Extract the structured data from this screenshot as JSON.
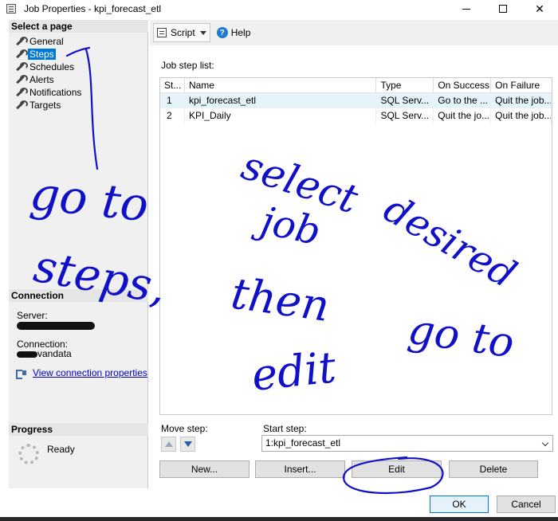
{
  "window": {
    "title": "Job Properties - kpi_forecast_etl"
  },
  "left": {
    "select_page_header": "Select a page",
    "pages": [
      {
        "label": "General",
        "selected": false
      },
      {
        "label": "Steps",
        "selected": true
      },
      {
        "label": "Schedules",
        "selected": false
      },
      {
        "label": "Alerts",
        "selected": false
      },
      {
        "label": "Notifications",
        "selected": false
      },
      {
        "label": "Targets",
        "selected": false
      }
    ],
    "connection_header": "Connection",
    "server_label": "Server:",
    "connection_label": "Connection:",
    "connection_value_suffix": "vandata",
    "view_connection_link": "View connection properties",
    "progress_header": "Progress",
    "progress_status": "Ready"
  },
  "toolbar": {
    "script_label": "Script",
    "help_label": "Help"
  },
  "steps": {
    "list_label": "Job step list:",
    "columns": [
      "St...",
      "Name",
      "Type",
      "On Success",
      "On Failure"
    ],
    "rows": [
      [
        "1",
        "kpi_forecast_etl",
        "SQL Serv...",
        "Go to the ...",
        "Quit the job..."
      ],
      [
        "2",
        "KPI_Daily",
        "SQL Serv...",
        "Quit the jo...",
        "Quit the job..."
      ]
    ],
    "move_step_label": "Move step:",
    "start_step_label": "Start step:",
    "start_step_value": "1:kpi_forecast_etl",
    "buttons": {
      "new": "New...",
      "insert": "Insert...",
      "edit": "Edit",
      "delete": "Delete"
    }
  },
  "footer": {
    "ok": "OK",
    "cancel": "Cancel"
  },
  "annotation": {
    "color": "#1010c8",
    "words": [
      "go to",
      "steps,",
      "select",
      "job",
      "desired",
      "then",
      "go to",
      "edit"
    ]
  }
}
